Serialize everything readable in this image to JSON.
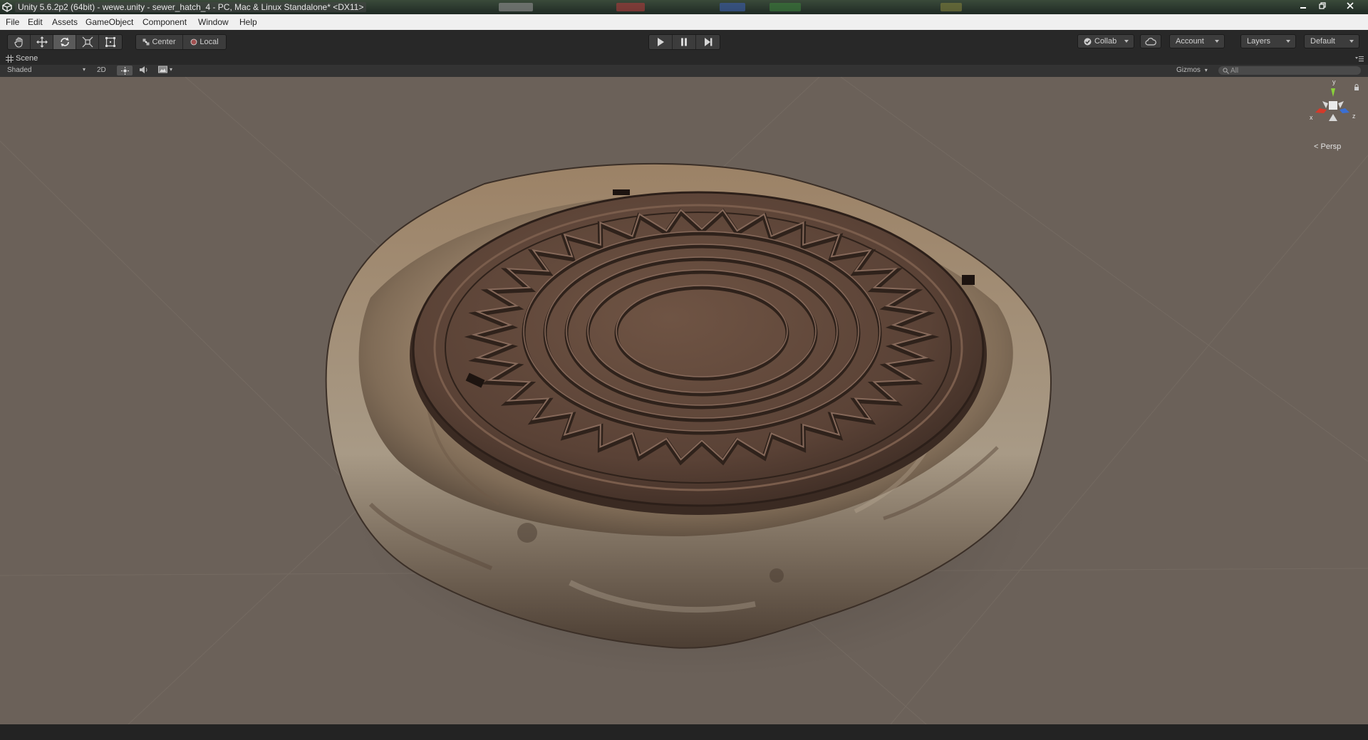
{
  "window": {
    "title": "Unity 5.6.2p2 (64bit) - wewe.unity - sewer_hatch_4 - PC, Mac & Linux Standalone* <DX11>",
    "controls": [
      "minimize",
      "restore",
      "close"
    ]
  },
  "menubar": {
    "items": [
      {
        "label": "File"
      },
      {
        "label": "Edit"
      },
      {
        "label": "Assets"
      },
      {
        "label": "GameObject"
      },
      {
        "label": "Component"
      },
      {
        "label": "Window"
      },
      {
        "label": "Help"
      }
    ]
  },
  "toolbar": {
    "tools": [
      "hand-tool-icon",
      "move-tool-icon",
      "rotate-tool-icon",
      "scale-tool-icon",
      "rect-tool-icon"
    ],
    "active_tool": "rotate",
    "pivot_mode": "Center",
    "pivot_rotation": "Local",
    "playback": [
      "play-icon",
      "pause-icon",
      "step-icon"
    ],
    "collab_label": "Collab",
    "account_label": "Account",
    "layers_label": "Layers",
    "layout_label": "Default"
  },
  "scene_tab": {
    "label": "Scene",
    "shading_mode": "Shaded",
    "mode_2d": "2D",
    "gizmos_label": "Gizmos",
    "search_placeholder": "All"
  },
  "orientation_gizmo": {
    "axes": {
      "y": "y",
      "x": "x",
      "z": "z"
    },
    "projection": "Persp",
    "axis_colors": {
      "x": "#d43a2a",
      "y": "#8ad13a",
      "z": "#3a6fd4"
    }
  },
  "scene_objects": [
    {
      "name": "sewer_hatch_4",
      "kind": "manhole-cover-on-rock"
    }
  ],
  "colors": {
    "viewport_background": "#6b6159",
    "toolbar_background": "#282828",
    "hatch_metal": "#5c4438",
    "rock": "#9a8570"
  }
}
